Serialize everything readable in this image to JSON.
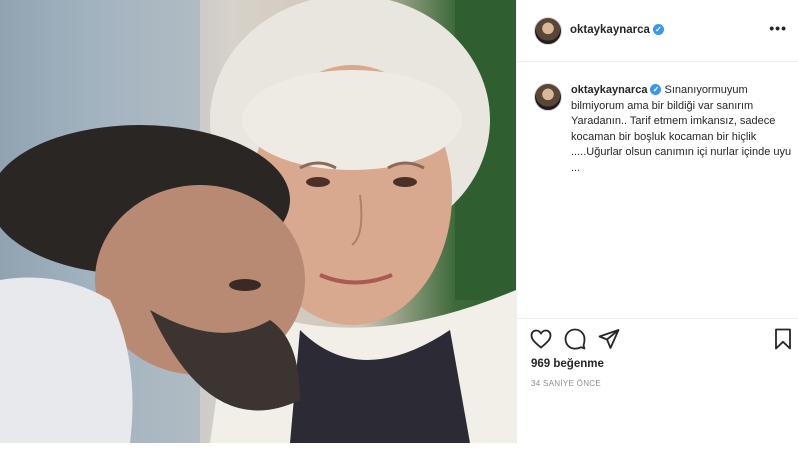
{
  "post": {
    "username": "oktaykaynarca",
    "verified_mark": "✓",
    "more_label": "•••",
    "caption_text": "Sınanıyormuyum bilmiyorum ama bir bildiği var sanırım Yaradanın.. Tarif etmem imkansız, sadece kocaman bir boşluk kocaman bir hiçlik .....Uğurlar olsun canımın içi nurlar içinde uyu ...",
    "likes": "969 beğenme",
    "time_ago": "34 SANİYE ÖNCE"
  },
  "icons": {
    "like": "heart-icon",
    "comment": "comment-icon",
    "share": "paper-plane-icon",
    "save": "bookmark-icon",
    "more": "more-options-icon"
  },
  "colors": {
    "verified_badge": "#3897f0",
    "text": "#262626",
    "muted": "#8e8e8e",
    "border": "#efefef"
  }
}
